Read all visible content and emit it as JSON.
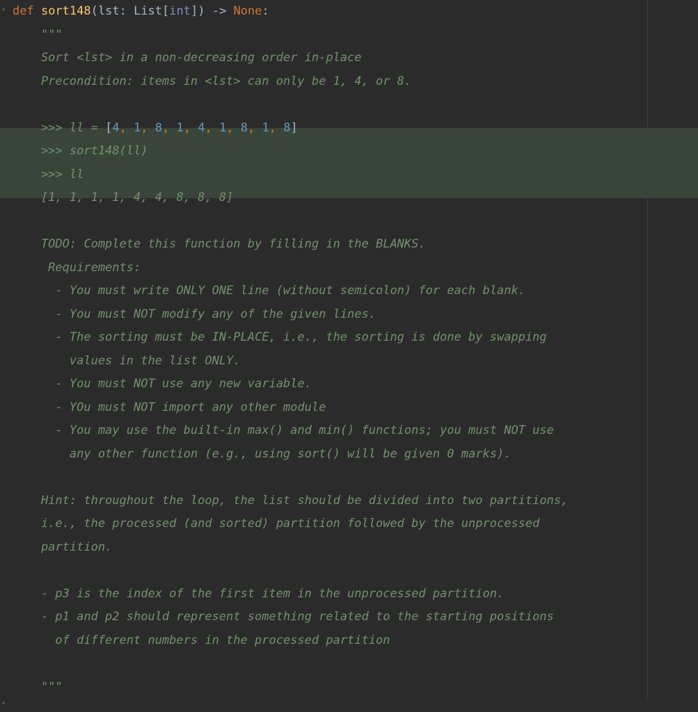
{
  "code": {
    "def_keyword": "def ",
    "function_name": "sort148",
    "paren_open": "(",
    "param_name": "lst",
    "colon_type": ": ",
    "type_list": "List",
    "bracket_open": "[",
    "type_int": "int",
    "bracket_close": "]",
    "paren_close": ")",
    "arrow": " -> ",
    "return_type": "None",
    "def_colon": ":",
    "triple_quote_open": "    \"\"\"",
    "doc_line1": "    Sort <lst> in a non-decreasing order in-place",
    "doc_line2": "    Precondition: items in <lst> can only be 1, 4, or 8.",
    "empty1": "",
    "doctest_prefix1": "    >>> ll = ",
    "list_open": "[",
    "n1": "4",
    "n2": "1",
    "n3": "8",
    "n4": "1",
    "n5": "4",
    "n6": "1",
    "n7": "8",
    "n8": "1",
    "n9": "8",
    "list_close": "]",
    "comma_sep": ", ",
    "doctest_line2": "    >>> sort148(ll)",
    "doctest_line3": "    >>> ll",
    "doctest_result": "    [1, 1, 1, 1, 4, 4, 8, 8, 8]",
    "empty2": "",
    "todo": "    TODO: Complete this function by filling in the BLANKS.",
    "req_header": "     Requirements:",
    "req1": "      - You must write ONLY ONE line (without semicolon) for each blank.",
    "req2": "      - You must NOT modify any of the given lines.",
    "req3a": "      - The sorting must be IN-PLACE, i.e., the sorting is done by swapping",
    "req3b": "        values in the list ONLY.",
    "req4": "      - You must NOT use any new variable.",
    "req5": "      - YOu must NOT import any other module",
    "req6a": "      - You may use the built-in max() and min() functions; you must NOT use",
    "req6b": "        any other function (e.g., using sort() will be given 0 marks).",
    "empty3": "",
    "hint1": "    Hint: throughout the loop, the list should be divided into two partitions,",
    "hint2": "    i.e., the processed (and sorted) partition followed by the unprocessed",
    "hint3": "    partition.",
    "empty4": "",
    "hint_p3": "    - p3 is the index of the first item in the unprocessed partition.",
    "hint_p12a": "    - p1 and p2 should represent something related to the starting positions",
    "hint_p12b": "      of different numbers in the processed partition",
    "empty5": "",
    "triple_quote_close": "    \"\"\""
  },
  "icons": {
    "fold_down": "▾",
    "fold_up": "▴"
  }
}
